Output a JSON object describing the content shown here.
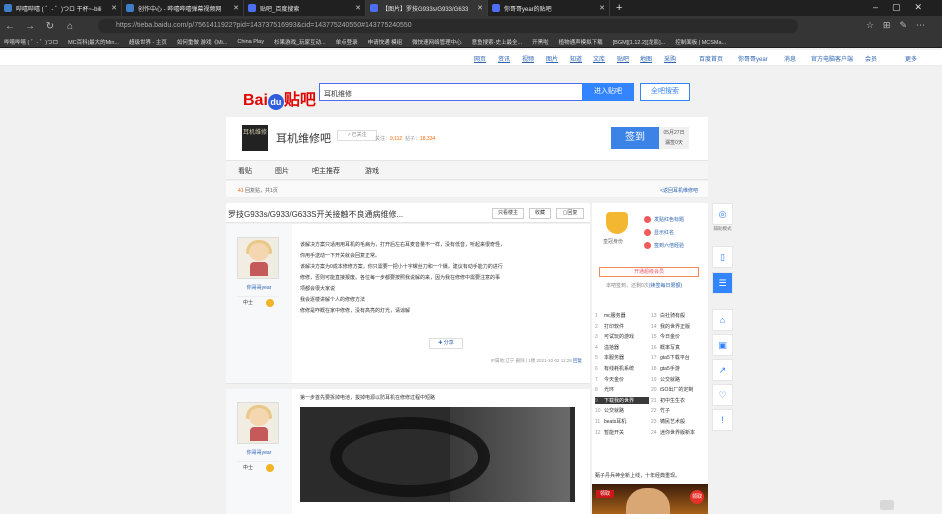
{
  "browser": {
    "tabs": [
      {
        "label": "哔嘻哔嘻 ( ゜- ゜)つロ 干杯~-bili",
        "icon": "bilibili-icon",
        "color": "#3e7ec9"
      },
      {
        "label": "创作中心 - 哔嘻哔嘻弹幕视频网",
        "icon": "bilibili-icon",
        "color": "#3e7ec9"
      },
      {
        "label": "贴吧_百度搜索",
        "icon": "baidu-paw-icon",
        "color": "#4e6ef2"
      },
      {
        "label": "【图片】罗技G933s/G933/G633",
        "icon": "baidu-paw-icon",
        "color": "#4e6ef2"
      },
      {
        "label": "你哥哥year的贴吧",
        "icon": "baidu-paw-icon",
        "color": "#4e6ef2"
      }
    ],
    "url": "https://tieba.baidu.com/p/7561411922?pid=143737516993&cid=143775240550#143775240550",
    "bookmarks": [
      "哔嘻哔嘻 ( ゜- ゜)つロ",
      "MC百科|最大的Min...",
      "超级世界 - 主页",
      "如何重做 游戏《Mi...",
      "China Play",
      "杉果游戏_玩家互动...",
      "单点登录",
      "申请快通 模组",
      "微快速网络管理中心",
      "意鱼搜索-史上最全...",
      "开黑啦",
      "植物通声模拟下载",
      "[BGM][1.12.2][龙影]...",
      "控制面板 | MCSMa..."
    ]
  },
  "topnav": {
    "left": [
      "网页",
      "资讯",
      "视频",
      "图片",
      "知道",
      "文库",
      "贴吧",
      "地图",
      "采购"
    ],
    "right": [
      "百度首页",
      "你哥哥year",
      "消息",
      "官方电脑客户端",
      "会员",
      "更多"
    ]
  },
  "search": {
    "logo_text": "Bai",
    "logo_du": "du",
    "logo_suffix": "贴吧",
    "value": "耳机维修",
    "btn_enter": "进入贴吧",
    "btn_all": "全吧搜索"
  },
  "forum": {
    "avatar_text": "耳机维修",
    "name": "耳机维修吧",
    "follow": "已关注",
    "sign_label": "签到",
    "stats_label_follow": "关注：",
    "stats_follow": "9,112",
    "stats_label_posts": "帖子：",
    "stats_posts": "18,334",
    "sign_date": "05月27日",
    "sign_streak": "漏签0天",
    "tabs": [
      "看贴",
      "图片",
      "吧主推荐",
      "游戏"
    ],
    "reply_count": "41",
    "reply_label": "回复贴，共1页",
    "back_link": "<返回耳机维修吧"
  },
  "thread": {
    "title": "罗技G933s/G933/G633S开关接触不良通病维修...",
    "btn_host": "只看楼主",
    "btn_fav": "收藏",
    "btn_reply": "回复"
  },
  "posts": [
    {
      "user": "你哥哥year",
      "rank": "中士",
      "lines": [
        "该解决方案只适用用耳机的毛病为，打开后左右耳麦音量不一样，没有低音，听起来很奇怪，",
        "你用手送动一下开关就会回复正常。",
        "该解决方案为0成本修修方案，你只需要一把小十字螺丝刀和一个镊。建议有动手能力的进行",
        "修修，否则可能直接报废。各位每一步都要按照我说解的来，因为我在修修中需要注意的事",
        "项都会很大家说",
        "我会逐楼讲解个人的修修方法",
        "修修是咋概在家中修修，没有高亮的灯光，请谅解"
      ],
      "share": "分享",
      "report": "IP属地:辽宁",
      "delete": "删除",
      "floor": "1楼",
      "time": "2021-10-02 11:29",
      "reply": "回复"
    },
    {
      "user": "你哥哥year",
      "rank": "中士",
      "text": "第一步首先要拆掉电池，拔掉电源以防耳机在修修过程中短路"
    }
  ],
  "right": {
    "crown_label": "皇冠身份",
    "actions": [
      "发贴红色标题",
      "显示红名",
      "签到六倍经验"
    ],
    "member_btn": "开通超级会员",
    "remain": "本吧签到，还剩",
    "remain_count": "0",
    "remain_suffix": "次",
    "remain_link": "(续签每日限额)",
    "hot": [
      [
        "1",
        "mc服务器",
        "13",
        "白社骑有般"
      ],
      [
        "2",
        "打印软件",
        "14",
        "我的世界正版"
      ],
      [
        "3",
        "可试玩的游戏",
        "15",
        "今日金价"
      ],
      [
        "4",
        "溢拾器",
        "16",
        "概率写真"
      ],
      [
        "5",
        "本服务器",
        "17",
        "gta5下载平台"
      ],
      [
        "6",
        "有线耗机系统",
        "18",
        "gta5手游"
      ],
      [
        "7",
        "今天金价",
        "19",
        "公交就路"
      ],
      [
        "8",
        "光环",
        "20",
        "iSO出厂的定制"
      ],
      [
        "9",
        "下载我的世界",
        "21",
        "初中生生衣"
      ],
      [
        "10",
        "公交就路",
        "22",
        "竹子"
      ],
      [
        "11",
        "beats耳机",
        "23",
        "铸民艺术般"
      ],
      [
        "12",
        "暂能开关",
        "24",
        "迷你世界版新本"
      ]
    ],
    "hot_highlight": "9",
    "banner": "甄子丹兵神全新上线，十年经典重现。",
    "promo_left": "领取",
    "promo_right": "领取"
  },
  "floating": {
    "items": [
      {
        "label": "辅助模式",
        "icon": "accessibility-icon"
      },
      {
        "label": "",
        "icon": "phone-icon"
      },
      {
        "label": "",
        "icon": "comment-icon"
      },
      {
        "label": "",
        "icon": "store-icon"
      },
      {
        "label": "",
        "icon": "gift-icon"
      },
      {
        "label": "",
        "icon": "share-icon"
      },
      {
        "label": "",
        "icon": "heart-icon"
      },
      {
        "label": "",
        "icon": "report-icon"
      }
    ]
  }
}
